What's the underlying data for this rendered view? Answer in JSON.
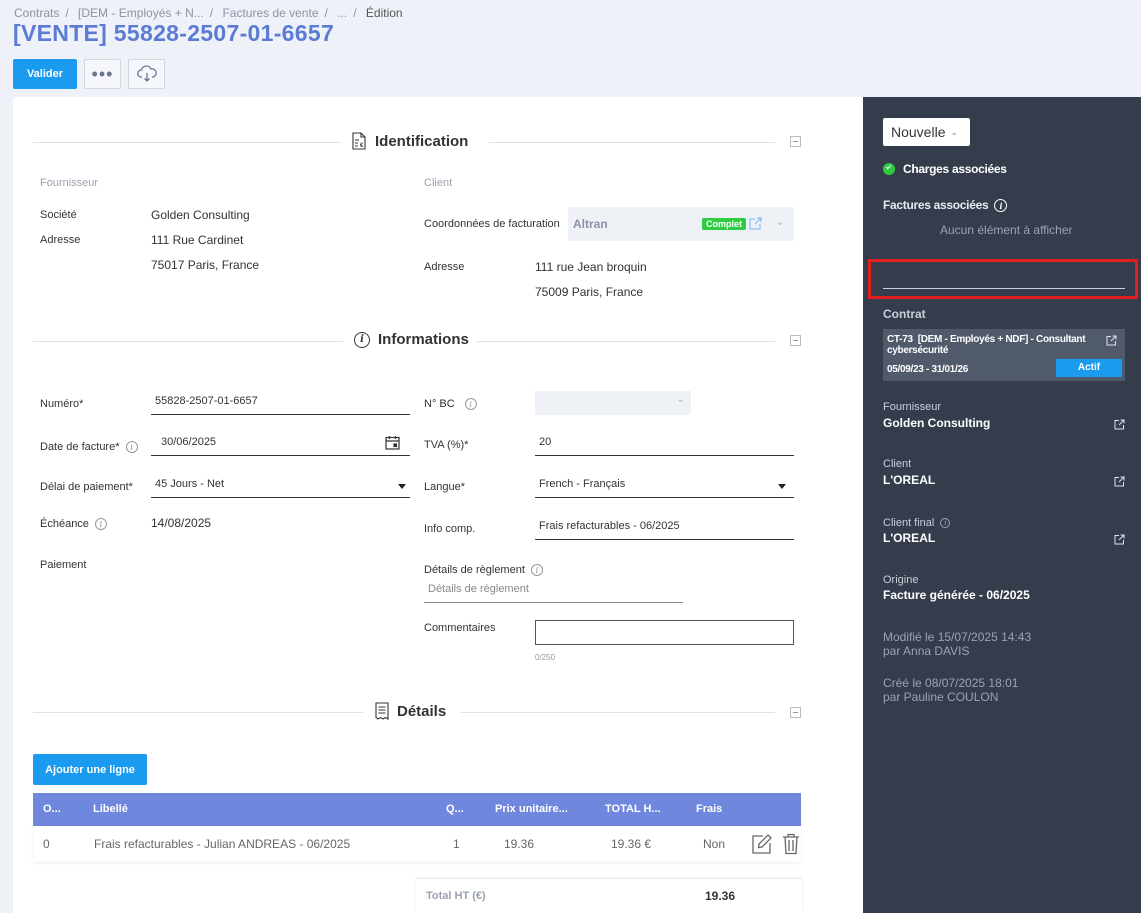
{
  "breadcrumb": {
    "items": [
      "Contrats",
      "[DEM - Employés + N...",
      "Factures de vente",
      "...",
      "Édition"
    ]
  },
  "page_title": "[VENTE] 55828-2507-01-6657",
  "toolbar": {
    "validate_label": "Valider",
    "more_icon": "ellipsis-icon",
    "download_icon": "cloud-download-icon"
  },
  "identification": {
    "title": "Identification",
    "supplier_heading": "Fournisseur",
    "client_heading": "Client",
    "company_label": "Société",
    "company_value": "Golden Consulting",
    "address_label": "Adresse",
    "address_line1": "111 Rue Cardinet",
    "address_line2": "75017 Paris, France",
    "billing_label": "Coordonnées de facturation",
    "billing_value": "Altran",
    "billing_badge": "Complet",
    "client_address_label": "Adresse",
    "client_address_line1": "111 rue Jean broquin",
    "client_address_line2": "75009 Paris, France"
  },
  "informations": {
    "title": "Informations",
    "numero_label": "Numéro*",
    "numero_value": "55828-2507-01-6657",
    "invoice_date_label": "Date de facture*",
    "invoice_date_value": "30/06/2025",
    "payment_delay_label": "Délai de paiement*",
    "payment_delay_value": "45 Jours - Net",
    "due_label": "Échéance",
    "due_value": "14/08/2025",
    "payment_label": "Paiement",
    "bc_label": "N° BC",
    "tva_label": "TVA (%)*",
    "tva_value": "20",
    "language_label": "Langue*",
    "language_value": "French - Français",
    "info_label": "Info comp.",
    "info_value": "Frais refacturables - 06/2025",
    "settlement_label": "Détails de règlement",
    "settlement_placeholder": "Détails de règlement",
    "comments_label": "Commentaires",
    "comments_counter": "0/250"
  },
  "details": {
    "title": "Détails",
    "add_line_label": "Ajouter une ligne",
    "columns": [
      "O...",
      "Libellé",
      "Q...",
      "Prix unitaire...",
      "TOTAL H...",
      "Frais"
    ],
    "rows": [
      {
        "order": "0",
        "label": "Frais refacturables - Julian ANDREAS - 06/2025",
        "qty": "1",
        "unit_price": "19.36",
        "total": "19.36 €",
        "fees": "Non"
      }
    ],
    "total_label": "Total HT (€)",
    "total_value": "19.36"
  },
  "sidebar": {
    "status_button": "Nouvelle",
    "charges_label": "Charges associées",
    "invoices_label": "Factures associées",
    "invoices_empty": "Aucun élément à afficher",
    "contract_heading": "Contrat",
    "contract_code": "CT-73",
    "contract_title": "[DEM - Employés + NDF] - Consultant cybersécurité",
    "contract_dates": "05/09/23 - 31/01/26",
    "contract_status": "Actif",
    "supplier_heading": "Fournisseur",
    "supplier_value": "Golden Consulting",
    "client_heading": "Client",
    "client_value": "L'OREAL",
    "final_client_heading": "Client final",
    "final_client_value": "L'OREAL",
    "origin_heading": "Origine",
    "origin_value": "Facture générée - 06/2025",
    "modified_line1": "Modifié le   15/07/2025 14:43",
    "modified_line2": "par Anna DAVIS",
    "created_line1": "Créé le   08/07/2025 18:01",
    "created_line2": "par Pauline COULON"
  },
  "colors": {
    "accent": "#1a9bf0",
    "title": "#5b7bd5",
    "table_header": "#6f87dd",
    "sidebar_bg": "#353d4d",
    "success": "#2ecc40",
    "highlight": "#e0201c"
  }
}
